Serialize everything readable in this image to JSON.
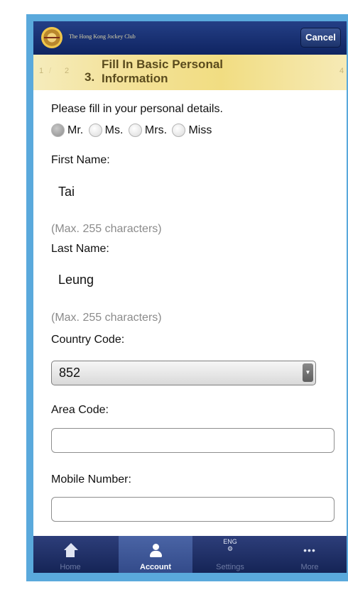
{
  "header": {
    "brand": "The Hong Kong Jockey Club",
    "cancel_label": "Cancel"
  },
  "steps": {
    "prev1": "1",
    "prev2": "2",
    "current_number": "3.",
    "current_title": "Fill In Basic Personal Information",
    "next": "4"
  },
  "form": {
    "intro": "Please fill in your personal details.",
    "titles": [
      {
        "label": "Mr.",
        "selected": true
      },
      {
        "label": "Ms.",
        "selected": false
      },
      {
        "label": "Mrs.",
        "selected": false
      },
      {
        "label": "Miss",
        "selected": false
      }
    ],
    "first_name_label": "First Name:",
    "first_name_value": "Tai",
    "first_name_hint": "(Max. 255 characters)",
    "last_name_label": "Last Name:",
    "last_name_value": "Leung",
    "last_name_hint": "(Max. 255 characters)",
    "country_code_label": "Country Code:",
    "country_code_value": "852",
    "area_code_label": "Area Code:",
    "area_code_value": "",
    "mobile_label": "Mobile Number:",
    "mobile_value": ""
  },
  "tabbar": {
    "home": "Home",
    "account": "Account",
    "settings": "Settings",
    "settings_icon_text": "ENG",
    "more": "More",
    "active": "account"
  }
}
